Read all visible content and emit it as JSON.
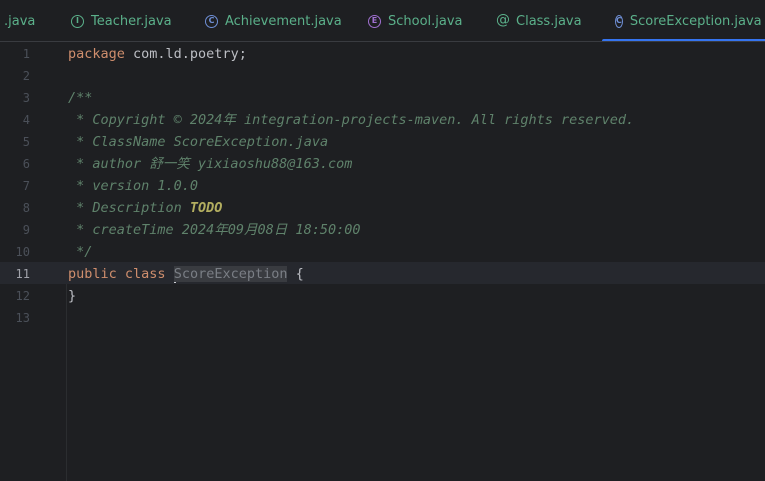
{
  "tabs": [
    {
      "label": ".java",
      "icon": "none"
    },
    {
      "label": "Teacher.java",
      "icon": "interface-icon"
    },
    {
      "label": "Achievement.java",
      "icon": "class-icon"
    },
    {
      "label": "School.java",
      "icon": "enum-icon"
    },
    {
      "label": "Class.java",
      "icon": "annotation-icon"
    },
    {
      "label": "ScoreException.java",
      "icon": "class-icon",
      "active": true
    }
  ],
  "close_glyph": "×",
  "current_line": 11,
  "lines": [
    {
      "n": "1",
      "t": [
        {
          "s": "package ",
          "c": "kw"
        },
        {
          "s": "com.ld.poetry;"
        }
      ]
    },
    {
      "n": "2",
      "t": []
    },
    {
      "n": "3",
      "t": [
        {
          "s": "/**",
          "c": "doc"
        }
      ]
    },
    {
      "n": "4",
      "t": [
        {
          "s": " * Copyright © 2024年 integration-projects-maven. All rights reserved.",
          "c": "doc"
        }
      ]
    },
    {
      "n": "5",
      "t": [
        {
          "s": " * ClassName ScoreException.java",
          "c": "doc"
        }
      ]
    },
    {
      "n": "6",
      "t": [
        {
          "s": " * author 舒一笑 yixiaoshu88@163.com",
          "c": "doc"
        }
      ]
    },
    {
      "n": "7",
      "t": [
        {
          "s": " * version 1.0.0",
          "c": "doc"
        }
      ]
    },
    {
      "n": "8",
      "t": [
        {
          "s": " * Description ",
          "c": "doc"
        },
        {
          "s": "TODO",
          "c": "todo"
        }
      ]
    },
    {
      "n": "9",
      "t": [
        {
          "s": " * createTime 2024年09月08日 18:50:00",
          "c": "doc"
        }
      ]
    },
    {
      "n": "10",
      "t": [
        {
          "s": " */",
          "c": "doc"
        }
      ]
    },
    {
      "n": "11",
      "t": [
        {
          "s": "public ",
          "c": "kw"
        },
        {
          "s": "class ",
          "c": "kw"
        },
        {
          "s": "",
          "c": "caret"
        },
        {
          "s": "ScoreException",
          "c": "sel"
        },
        {
          "s": " {"
        }
      ]
    },
    {
      "n": "12",
      "t": [
        {
          "s": "}"
        }
      ]
    },
    {
      "n": "13",
      "t": []
    }
  ]
}
